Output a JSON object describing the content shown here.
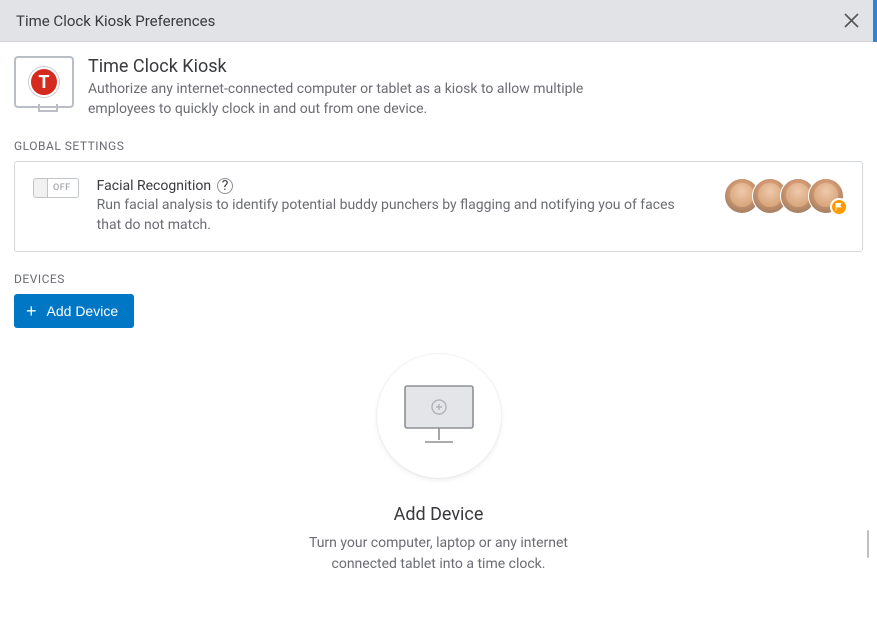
{
  "header": {
    "title": "Time Clock Kiosk Preferences"
  },
  "intro": {
    "icon_letter": "T",
    "title": "Time Clock Kiosk",
    "description": "Authorize any internet-connected computer or tablet as a kiosk to allow multiple employees to quickly clock in and out from one device."
  },
  "sections": {
    "global_settings": "GLOBAL SETTINGS",
    "devices": "DEVICES"
  },
  "facial_recognition": {
    "toggle_state": "OFF",
    "title": "Facial Recognition",
    "description": "Run facial analysis to identify potential buddy punchers by flagging and notifying you of faces that do not match."
  },
  "add_device_button": "Add Device",
  "empty_state": {
    "title": "Add Device",
    "description_line1": "Turn your computer, laptop or any internet",
    "description_line2": "connected tablet into a time clock."
  }
}
